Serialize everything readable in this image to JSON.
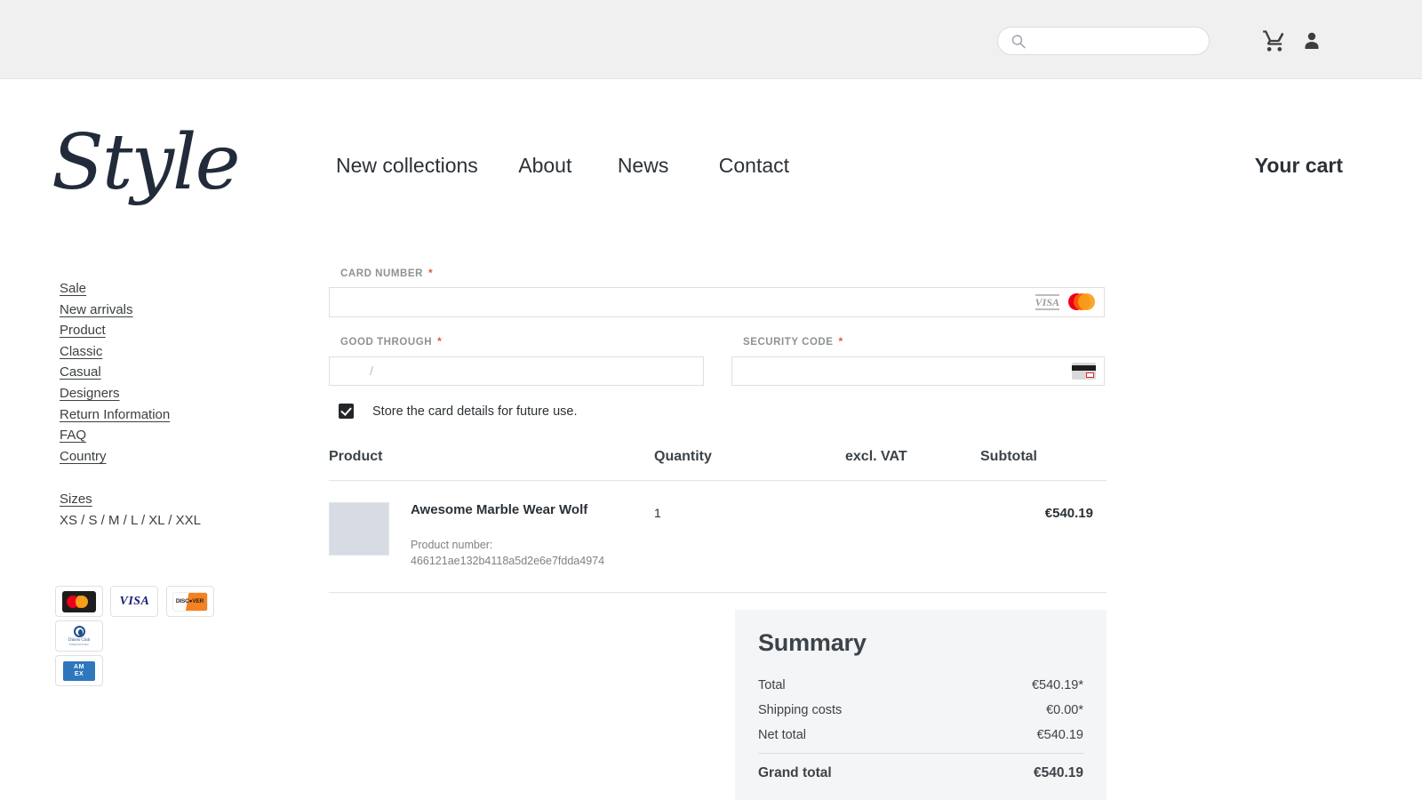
{
  "topbar": {
    "search_placeholder": "",
    "search_value": "",
    "cart_icon": "shopping-cart-icon",
    "account_icon": "user-account-icon"
  },
  "brand": {
    "logo_text": "Style"
  },
  "nav": {
    "items": [
      {
        "label": "New collections"
      },
      {
        "label": "About"
      },
      {
        "label": "News"
      },
      {
        "label": "Contact"
      }
    ],
    "cart_label": "Your cart"
  },
  "sidebar": {
    "links": [
      {
        "label": "Sale"
      },
      {
        "label": "New arrivals"
      },
      {
        "label": "Product"
      },
      {
        "label": "Classic"
      },
      {
        "label": "Casual"
      },
      {
        "label": "Designers"
      },
      {
        "label": "Return Information"
      },
      {
        "label": "FAQ"
      },
      {
        "label": "Country"
      }
    ],
    "sizes_heading": "Sizes",
    "sizes_values": "XS / S / M / L / XL / XXL",
    "payment_badges": [
      {
        "name": "mastercard"
      },
      {
        "name": "visa",
        "text": "VISA"
      },
      {
        "name": "discover",
        "text": "DISC●VER"
      },
      {
        "name": "diners-club",
        "text": "Diners Club",
        "subtext": "INTERNATIONAL"
      },
      {
        "name": "amex",
        "text_top": "AM",
        "text_bottom": "EX"
      }
    ]
  },
  "payment_form": {
    "card_number": {
      "label": "CARD NUMBER",
      "required_mark": "*",
      "value": "",
      "brand_icons": [
        "visa-icon",
        "mastercard-icon"
      ],
      "visa_text": "VISA"
    },
    "good_through": {
      "label": "GOOD THROUGH",
      "required_mark": "*",
      "value": "",
      "placeholder": "/"
    },
    "security_code": {
      "label": "SECURITY CODE",
      "required_mark": "*",
      "value": "",
      "hint_icon": "cvv-card-icon"
    },
    "store_card": {
      "label": "Store the card details for future use.",
      "checked": true
    }
  },
  "cart_table": {
    "headers": {
      "product": "Product",
      "quantity": "Quantity",
      "vat": "excl. VAT",
      "subtotal": "Subtotal"
    },
    "rows": [
      {
        "name": "Awesome Marble Wear Wolf",
        "product_number_label": "Product number:",
        "product_number": "466121ae132b4118a5d2e6e7fdda4974",
        "quantity": "1",
        "vat": "",
        "subtotal": "€540.19"
      }
    ]
  },
  "summary": {
    "title": "Summary",
    "rows": [
      {
        "label": "Total",
        "value": "€540.19*"
      },
      {
        "label": "Shipping costs",
        "value": "€0.00*"
      },
      {
        "label": "Net total",
        "value": "€540.19"
      }
    ],
    "grand": {
      "label": "Grand total",
      "value": "€540.19"
    }
  },
  "colors": {
    "topbar_bg": "#f0f0f0",
    "text": "#2b3136",
    "muted": "#8e9295",
    "required": "#e2573c",
    "summary_bg": "#f4f5f6",
    "thumb": "#d7dbe3"
  }
}
